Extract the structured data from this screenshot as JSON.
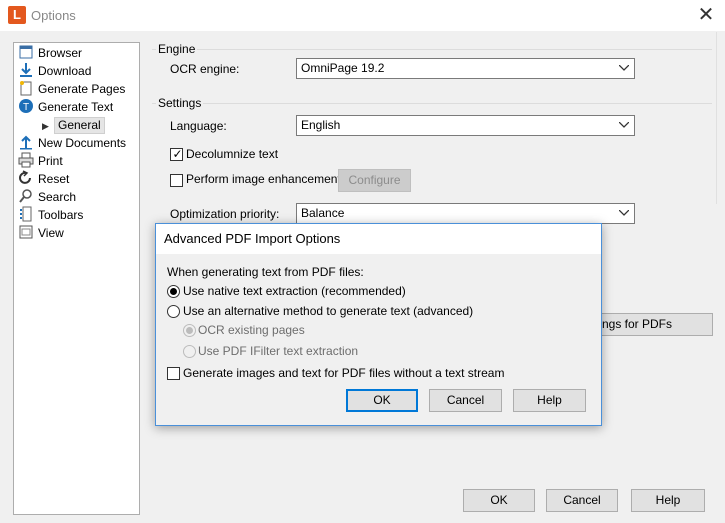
{
  "window": {
    "title": "Options",
    "app_icon_letter": "L"
  },
  "tree": [
    {
      "label": "Browser",
      "icon": "browser-icon"
    },
    {
      "label": "Download",
      "icon": "download-icon"
    },
    {
      "label": "Generate Pages",
      "icon": "generate-pages-icon"
    },
    {
      "label": "Generate Text",
      "icon": "generate-text-icon"
    },
    {
      "label": "General",
      "icon": "caret-right-icon",
      "selected": true
    },
    {
      "label": "New Documents",
      "icon": "new-documents-icon"
    },
    {
      "label": "Print",
      "icon": "print-icon"
    },
    {
      "label": "Reset",
      "icon": "reset-icon"
    },
    {
      "label": "Search",
      "icon": "search-icon"
    },
    {
      "label": "Toolbars",
      "icon": "toolbars-icon"
    },
    {
      "label": "View",
      "icon": "view-icon"
    }
  ],
  "engine": {
    "group_label": "Engine",
    "ocr_label": "OCR engine:",
    "ocr_value": "OmniPage 19.2"
  },
  "settings": {
    "group_label": "Settings",
    "language_label": "Language:",
    "language_value": "English",
    "decolumnize_label": "Decolumnize text",
    "decolumnize_checked": true,
    "enhancement_label": "Perform image enhancement",
    "enhancement_checked": false,
    "configure_label": "Configure",
    "priority_label": "Optimization priority:",
    "priority_value": "Balance"
  },
  "pdf_settings_button_partial": "ttings for PDFs",
  "footer": {
    "ok": "OK",
    "cancel": "Cancel",
    "help": "Help"
  },
  "dialog": {
    "title": "Advanced PDF Import Options",
    "intro": "When generating text from PDF files:",
    "options": [
      {
        "label": "Use native text extraction (recommended)",
        "selected": true,
        "enabled": true
      },
      {
        "label": "Use an alternative method to generate text (advanced)",
        "selected": false,
        "enabled": true
      }
    ],
    "sub_options": [
      {
        "label": "OCR existing pages",
        "selected": true,
        "enabled": false
      },
      {
        "label": "Use PDF IFilter text extraction",
        "selected": false,
        "enabled": false
      }
    ],
    "images_label": "Generate images and text for PDF files without a text stream",
    "images_checked": false,
    "ok": "OK",
    "cancel": "Cancel",
    "help": "Help"
  }
}
